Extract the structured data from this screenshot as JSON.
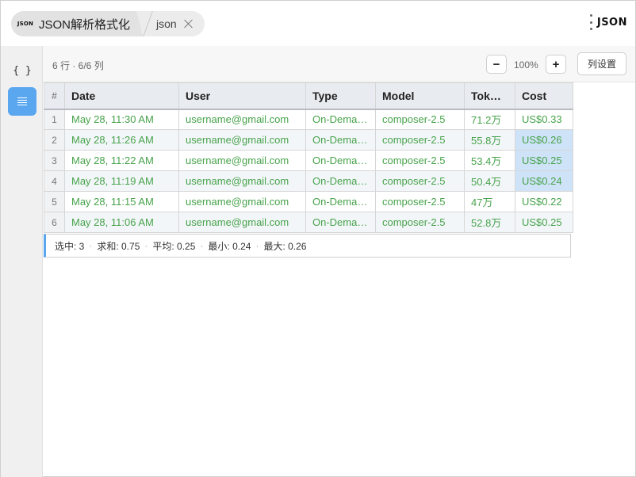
{
  "tabs": {
    "logo_text": "JSON",
    "main_label": "JSON解析格式化",
    "second_label": "json"
  },
  "brand": {
    "text": "JSON"
  },
  "sidebar": {
    "brace_icon": "{ }"
  },
  "toolbar": {
    "row_info": "6 行 · 6/6 列",
    "zoom_minus": "−",
    "zoom_level": "100%",
    "zoom_plus": "+",
    "column_settings": "列设置"
  },
  "table": {
    "columns": [
      "#",
      "Date",
      "User",
      "Type",
      "Model",
      "Tok…",
      "Cost"
    ],
    "rows": [
      {
        "idx": "1",
        "date": "May 28, 11:30 AM",
        "user": "username@gmail.com",
        "type": "On-Dema…",
        "model": "composer-2.5",
        "tokens": "71.2万",
        "cost": "US$0.33",
        "selected": false
      },
      {
        "idx": "2",
        "date": "May 28, 11:26 AM",
        "user": "username@gmail.com",
        "type": "On-Dema…",
        "model": "composer-2.5",
        "tokens": "55.8万",
        "cost": "US$0.26",
        "selected": true
      },
      {
        "idx": "3",
        "date": "May 28, 11:22 AM",
        "user": "username@gmail.com",
        "type": "On-Dema…",
        "model": "composer-2.5",
        "tokens": "53.4万",
        "cost": "US$0.25",
        "selected": true
      },
      {
        "idx": "4",
        "date": "May 28, 11:19 AM",
        "user": "username@gmail.com",
        "type": "On-Dema…",
        "model": "composer-2.5",
        "tokens": "50.4万",
        "cost": "US$0.24",
        "selected": true
      },
      {
        "idx": "5",
        "date": "May 28, 11:15 AM",
        "user": "username@gmail.com",
        "type": "On-Dema…",
        "model": "composer-2.5",
        "tokens": "47万",
        "cost": "US$0.22",
        "selected": false
      },
      {
        "idx": "6",
        "date": "May 28, 11:06 AM",
        "user": "username@gmail.com",
        "type": "On-Dema…",
        "model": "composer-2.5",
        "tokens": "52.8万",
        "cost": "US$0.25",
        "selected": false
      }
    ]
  },
  "status": {
    "items": [
      "选中: 3",
      "求和: 0.75",
      "平均: 0.25",
      "最小: 0.24",
      "最大: 0.26"
    ]
  },
  "colors": {
    "accent": "#5aa7f0",
    "cell_text": "#47a34b",
    "selected_cell": "#cfe3f8"
  }
}
